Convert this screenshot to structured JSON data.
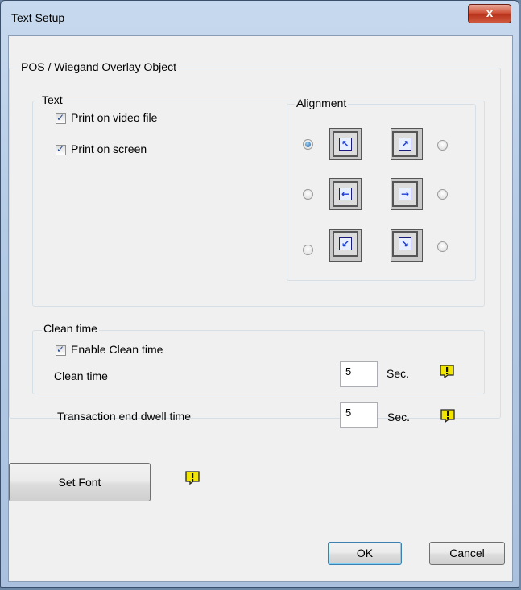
{
  "window": {
    "title": "Text Setup",
    "close_label": "x"
  },
  "main_group": {
    "label": "POS / Wiegand Overlay Object"
  },
  "text_group": {
    "label": "Text",
    "print_on_video_file": {
      "label": "Print on video file",
      "checked": true
    },
    "print_on_screen": {
      "label": "Print on screen",
      "checked": true
    }
  },
  "alignment": {
    "label": "Alignment",
    "options": [
      {
        "id": "top-left",
        "selected": true,
        "arrow": "↖"
      },
      {
        "id": "top-right",
        "selected": false,
        "arrow": "↗"
      },
      {
        "id": "middle-left",
        "selected": false,
        "arrow": "←"
      },
      {
        "id": "middle-right",
        "selected": false,
        "arrow": "→"
      },
      {
        "id": "bottom-left",
        "selected": false,
        "arrow": "↙"
      },
      {
        "id": "bottom-right",
        "selected": false,
        "arrow": "↘"
      }
    ]
  },
  "clean_group": {
    "label": "Clean time",
    "enable_clean_time": {
      "label": "Enable Clean time",
      "checked": true
    },
    "clean_time": {
      "label": "Clean time",
      "value": "5",
      "unit": "Sec."
    },
    "transaction_end_dwell_time": {
      "label": "Transaction end dwell time",
      "value": "5",
      "unit": "Sec."
    }
  },
  "buttons": {
    "set_font": "Set Font",
    "ok": "OK",
    "cancel": "Cancel"
  },
  "colors": {
    "warning_icon": "#f2e600",
    "accent": "#3c7fb1"
  },
  "icons": {
    "warning": "warning-exclamation-icon",
    "close": "close-icon"
  }
}
